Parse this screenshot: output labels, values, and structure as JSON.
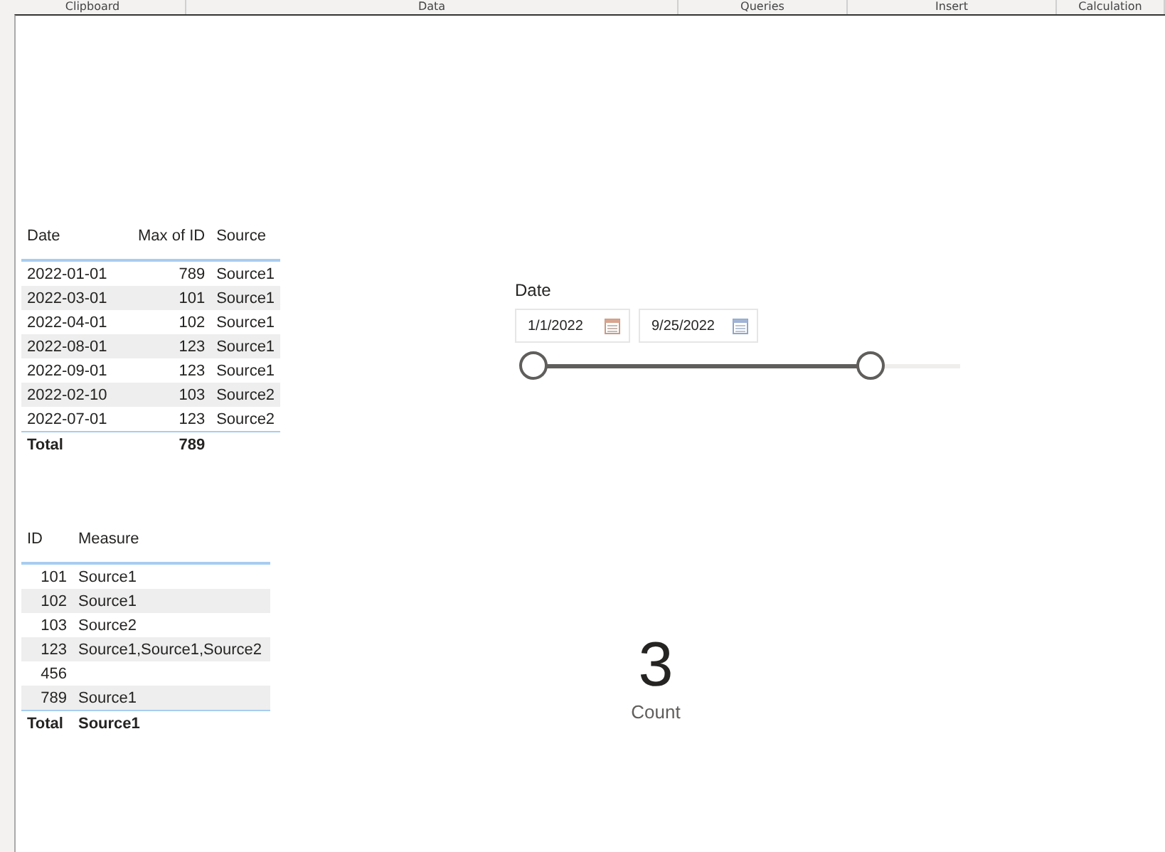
{
  "ribbon": {
    "groups": [
      "Clipboard",
      "Data",
      "Queries",
      "Insert",
      "Calculation"
    ]
  },
  "table1": {
    "columns": [
      "Date",
      "Max of ID",
      "Source"
    ],
    "rows": [
      [
        "2022-01-01",
        "789",
        "Source1"
      ],
      [
        "2022-03-01",
        "101",
        "Source1"
      ],
      [
        "2022-04-01",
        "102",
        "Source1"
      ],
      [
        "2022-08-01",
        "123",
        "Source1"
      ],
      [
        "2022-09-01",
        "123",
        "Source1"
      ],
      [
        "2022-02-10",
        "103",
        "Source2"
      ],
      [
        "2022-07-01",
        "123",
        "Source2"
      ]
    ],
    "total": [
      "Total",
      "789"
    ]
  },
  "table2": {
    "columns": [
      "ID",
      "Measure"
    ],
    "rows": [
      [
        "101",
        "Source1"
      ],
      [
        "102",
        "Source1"
      ],
      [
        "103",
        "Source2"
      ],
      [
        "123",
        "Source1,Source1,Source2"
      ],
      [
        "456",
        ""
      ],
      [
        "789",
        "Source1"
      ]
    ],
    "total": [
      "Total",
      "Source1"
    ]
  },
  "slicer": {
    "title": "Date",
    "start": "1/1/2022",
    "end": "9/25/2022",
    "level": 0.79
  },
  "card": {
    "value": "3",
    "label": "Count"
  }
}
